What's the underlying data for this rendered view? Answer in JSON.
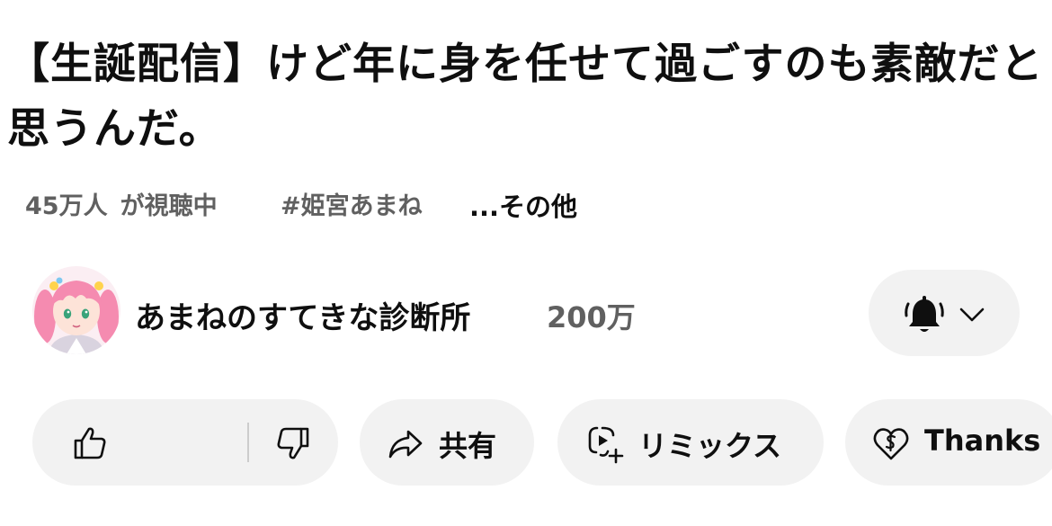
{
  "video": {
    "title": "【生誕配信】けど年に身を任せて過ごすのも素敵だと思うんだ。",
    "views_count": "45万人",
    "views_suffix": "が視聴中",
    "hashtag": "#姫宮あまね",
    "more_label": "...その他"
  },
  "channel": {
    "name": "あまねのすてきな診断所",
    "subscribers": "200万",
    "notification_icon": "bell-icon",
    "dropdown_icon": "chevron-down-icon"
  },
  "actions": {
    "share_label": "共有",
    "remix_label": "リミックス",
    "thanks_label": "Thanks"
  },
  "colors": {
    "pill_background": "#f2f2f2",
    "secondary_text": "#606060",
    "primary_text": "#0f0f0f"
  }
}
